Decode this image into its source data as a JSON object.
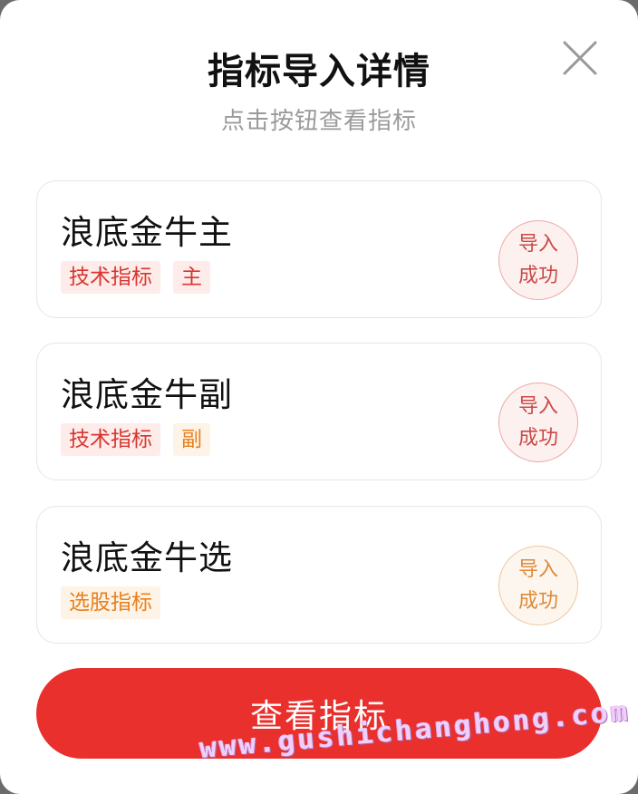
{
  "dialog": {
    "title": "指标导入详情",
    "subtitle": "点击按钮查看指标",
    "close_icon": "close-icon"
  },
  "cards": [
    {
      "name": "浪底金牛主",
      "tags": [
        {
          "text": "技术指标",
          "color": "#d9352f"
        },
        {
          "text": "主",
          "color": "#d9352f"
        }
      ],
      "status": {
        "line1": "导入",
        "line2": "成功",
        "color": "#c94a46"
      }
    },
    {
      "name": "浪底金牛副",
      "tags": [
        {
          "text": "技术指标",
          "color": "#d9352f"
        },
        {
          "text": "副",
          "color": "#e8801c"
        }
      ],
      "status": {
        "line1": "导入",
        "line2": "成功",
        "color": "#c94a46"
      }
    },
    {
      "name": "浪底金牛选",
      "tags": [
        {
          "text": "选股指标",
          "color": "#e8801c"
        }
      ],
      "status": {
        "line1": "导入",
        "line2": "成功",
        "color": "#de8a3a"
      }
    }
  ],
  "action": {
    "view_button_label": "查看指标",
    "accent_color": "#e9302d"
  },
  "watermark": "www.gushichanghong.com"
}
